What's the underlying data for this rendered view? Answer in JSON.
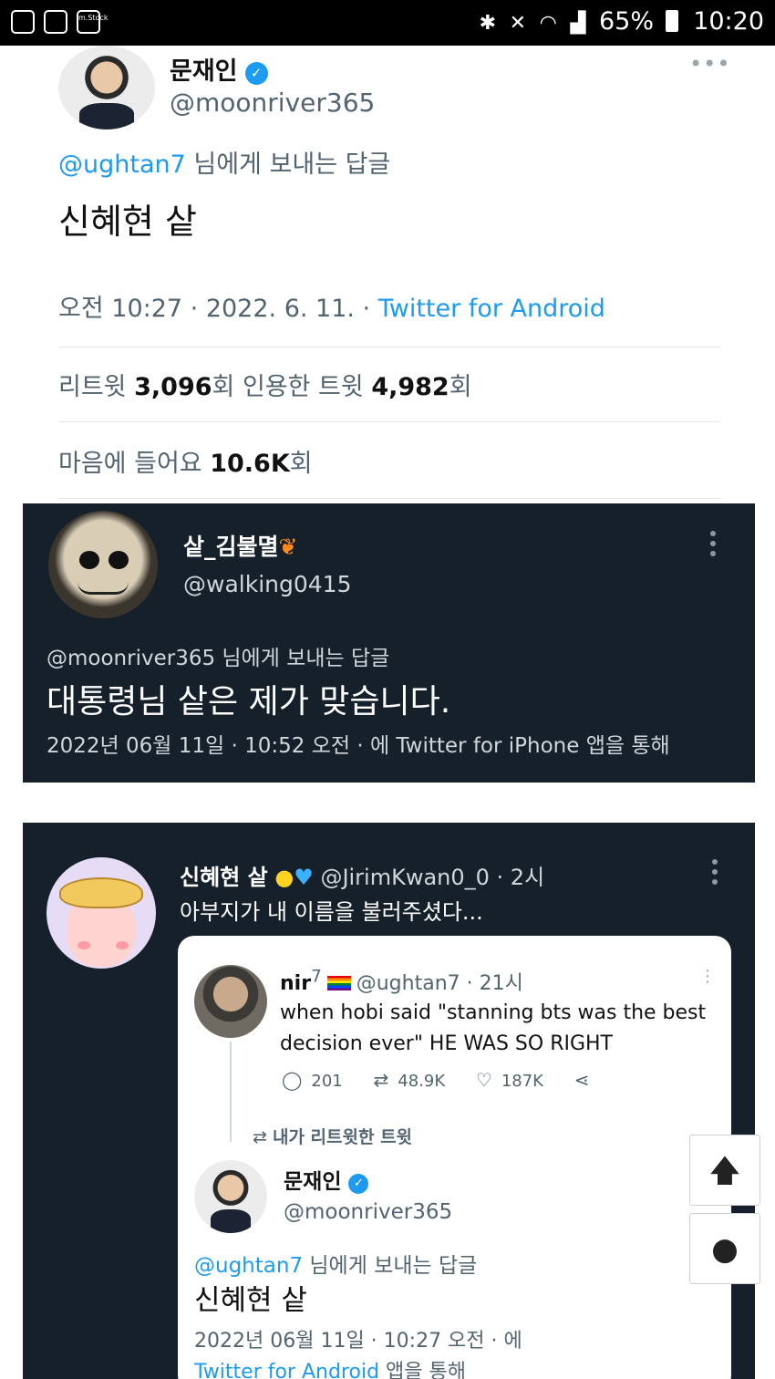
{
  "status_bar": {
    "battery": "65%",
    "time": "10:20",
    "app_icon_label": "m.Stock"
  },
  "tweet1": {
    "name": "문재인",
    "handle": "@moonriver365",
    "reply_mention": "@ughtan7",
    "reply_suffix": " 님에게 보내는 답글",
    "body": "신혜현 샅",
    "meta_time": "오전 10:27 · 2022. 6. 11. · ",
    "meta_source": "Twitter for Android",
    "retweets_label": "리트윗 ",
    "retweets_count": "3,096",
    "retweets_unit": "회  인용한 트윗 ",
    "quotes_count": "4,982",
    "quotes_unit": "회",
    "likes_label": "마음에 들어요 ",
    "likes_count": "10.6K",
    "likes_unit": "회"
  },
  "tweet2": {
    "name": "샅_김불멸",
    "handle": "@walking0415",
    "reply": "@moonriver365 님에게 보내는 답글",
    "body": "대통령님 샅은 제가 맞습니다.",
    "meta": "2022년 06월 11일 · 10:52 오전 · 에 Twitter for iPhone 앱을 통해"
  },
  "tweet3": {
    "name": "신혜현 샅",
    "handle": "@JirimKwan0_0",
    "time": " · 2시",
    "body": "아부지가 내 이름을 불러주셨다...",
    "quoted": {
      "nir_name": "nir",
      "nir_sup": "7",
      "nir_handle": "@ughtan7 · 21시",
      "nir_text": "when hobi said \"stanning bts was the best decision ever\" HE WAS SO RIGHT",
      "replies": "201",
      "retweets": "48.9K",
      "likes": "187K",
      "retweet_label": "내가 리트윗한 트윗",
      "moon_name": "문재인",
      "moon_handle": "@moonriver365",
      "moon_reply_mention": "@ughtan7",
      "moon_reply_suffix": " 님에게 보내는 답글",
      "moon_body": "신혜현 샅",
      "moon_meta": "2022년 06월 11일 · 10:27 오전 · 에",
      "moon_source": "Twitter for Android",
      "moon_source_suffix": " 앱을 통해"
    }
  },
  "colors": {
    "link_blue": "#1d9bf0",
    "dark_bg": "#15202b",
    "gray_text": "#536471"
  },
  "icons": [
    "camera-icon",
    "image-icon",
    "bluetooth-icon",
    "mute-icon",
    "wifi-icon",
    "signal-icon",
    "battery-icon",
    "verified-icon",
    "more-icon",
    "reply-icon",
    "retweet-icon",
    "heart-icon",
    "share-icon",
    "arrow-up-icon",
    "chat-icon"
  ]
}
